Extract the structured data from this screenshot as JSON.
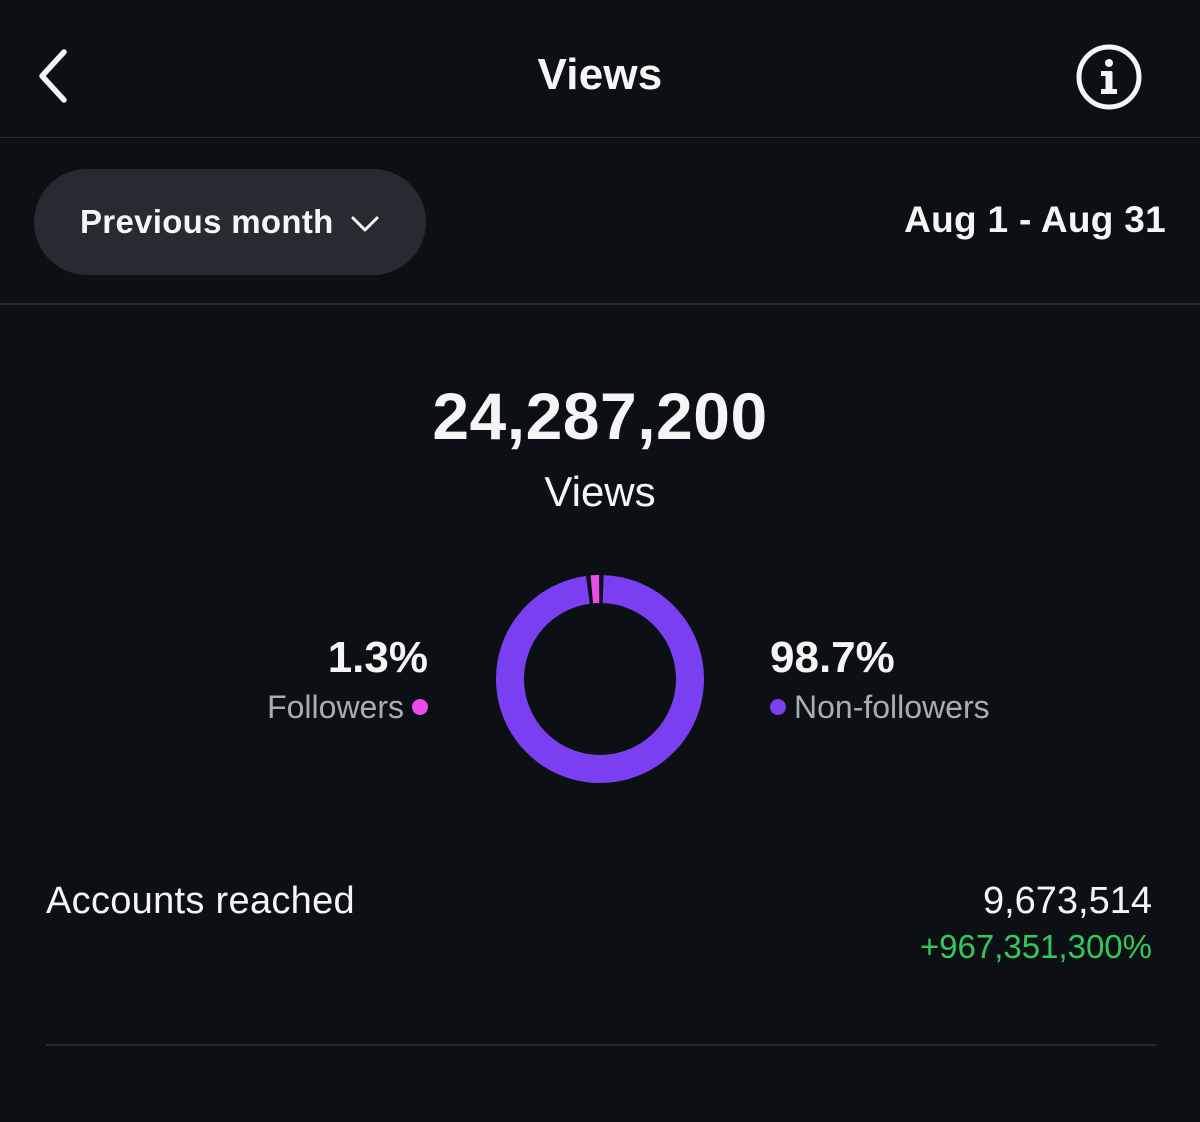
{
  "header": {
    "title": "Views",
    "back_icon": "chevron-left-icon",
    "info_icon": "info-icon"
  },
  "filter": {
    "period_label": "Previous month",
    "period_icon": "chevron-down-icon",
    "date_range": "Aug 1 - Aug 31"
  },
  "summary": {
    "total_value": "24,287,200",
    "total_label": "Views"
  },
  "breakdown": {
    "followers": {
      "percent_text": "1.3%",
      "label": "Followers",
      "fraction": 0.013,
      "color": "#e94de9"
    },
    "non_followers": {
      "percent_text": "98.7%",
      "label": "Non-followers",
      "fraction": 0.987,
      "color": "#7b3ff2"
    }
  },
  "accounts_reached": {
    "label": "Accounts reached",
    "value": "9,673,514",
    "change": "+967,351,300%",
    "change_color": "#34c759"
  },
  "colors": {
    "background": "#0c1014",
    "pill": "#262a31",
    "divider": "#262a2f"
  }
}
